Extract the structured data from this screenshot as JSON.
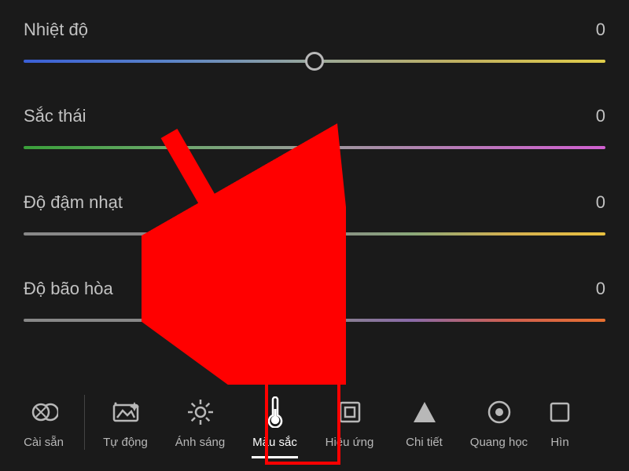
{
  "sliders": {
    "temp": {
      "label": "Nhiệt độ",
      "value": "0"
    },
    "tint": {
      "label": "Sắc thái",
      "value": "0"
    },
    "vibrance": {
      "label": "Độ đậm nhạt",
      "value": "0"
    },
    "sat": {
      "label": "Độ bão hòa",
      "value": "0"
    }
  },
  "toolbar": {
    "presets": "Cài sẵn",
    "auto": "Tự động",
    "light": "Ánh sáng",
    "color": "Màu sắc",
    "effects": "Hiệu ứng",
    "detail": "Chi tiết",
    "optics": "Quang học",
    "geometry": "Hìn"
  }
}
